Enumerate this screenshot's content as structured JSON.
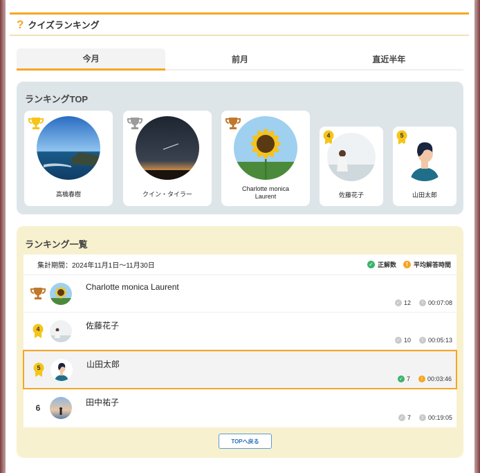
{
  "header": {
    "title": "クイズランキング"
  },
  "tabs": [
    {
      "label": "今月",
      "active": true
    },
    {
      "label": "前月",
      "active": false
    },
    {
      "label": "直近半年",
      "active": false
    }
  ],
  "top": {
    "title": "ランキングTOP",
    "cards": [
      {
        "rank": "1",
        "name": "高橋春樹"
      },
      {
        "rank": "2",
        "name": "クイン・タイラー"
      },
      {
        "rank": "3",
        "name": "Charlotte monica Laurent"
      },
      {
        "rank": "4",
        "name": "佐藤花子"
      },
      {
        "rank": "5",
        "name": "山田太郎"
      }
    ]
  },
  "list": {
    "title": "ランキング一覧",
    "period": "集計期間：2024年11月1日〜11月30日",
    "legend": {
      "correct": "正解数",
      "time": "平均解答時間"
    },
    "rows": [
      {
        "rank": "3",
        "name": "Charlotte monica Laurent",
        "correct": "12",
        "time": "00:07:08"
      },
      {
        "rank": "4",
        "name": "佐藤花子",
        "correct": "10",
        "time": "00:05:13"
      },
      {
        "rank": "5",
        "name": "山田太郎",
        "correct": "7",
        "time": "00:03:46"
      },
      {
        "rank": "6",
        "name": "田中祐子",
        "correct": "7",
        "time": "00:19:05"
      }
    ],
    "back_label": "TOPへ戻る"
  },
  "colors": {
    "accent": "#f5a623",
    "gold": "#f5c518",
    "silver": "#9b9b9b",
    "bronze": "#c0782c",
    "green": "#3bb36b",
    "blue": "#2a6fb5"
  }
}
